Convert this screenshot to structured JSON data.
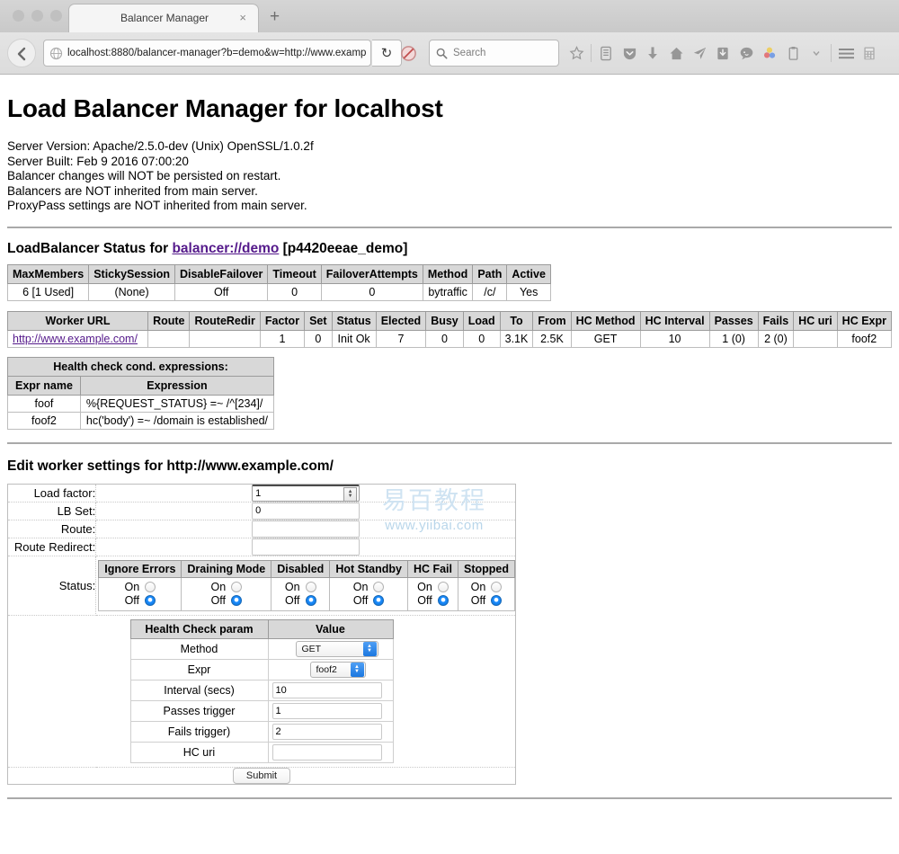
{
  "browser": {
    "tab_title": "Balancer Manager",
    "close_label": "×",
    "newtab_label": "+",
    "url": "localhost:8880/balancer-manager?b=demo&w=http://www.examp",
    "reload_label": "↻",
    "search_placeholder": "Search",
    "toolbar_icons": [
      "star-icon",
      "reader-list-icon",
      "pocket-icon",
      "download-icon",
      "home-icon",
      "send-icon",
      "save-page-icon",
      "chat-icon",
      "colorful-dots-icon",
      "clipboard-icon",
      "chevron-down-icon",
      "hamburger-menu-icon",
      "calculator-icon"
    ]
  },
  "page": {
    "title": "Load Balancer Manager for localhost",
    "server_info": [
      "Server Version: Apache/2.5.0-dev (Unix) OpenSSL/1.0.2f",
      "Server Built: Feb 9 2016 07:00:20",
      "Balancer changes will NOT be persisted on restart.",
      "Balancers are NOT inherited from main server.",
      "ProxyPass settings are NOT inherited from main server."
    ],
    "status_heading_prefix": "LoadBalancer Status for ",
    "status_heading_link": "balancer://demo",
    "status_heading_suffix": " [p4420eeae_demo]",
    "balancer_table": {
      "headers": [
        "MaxMembers",
        "StickySession",
        "DisableFailover",
        "Timeout",
        "FailoverAttempts",
        "Method",
        "Path",
        "Active"
      ],
      "row": [
        "6 [1 Used]",
        "(None)",
        "Off",
        "0",
        "0",
        "bytraffic",
        "/c/",
        "Yes"
      ]
    },
    "worker_table": {
      "headers": [
        "Worker URL",
        "Route",
        "RouteRedir",
        "Factor",
        "Set",
        "Status",
        "Elected",
        "Busy",
        "Load",
        "To",
        "From",
        "HC Method",
        "HC Interval",
        "Passes",
        "Fails",
        "HC uri",
        "HC Expr"
      ],
      "row": {
        "worker_url": "http://www.example.com/",
        "route": "",
        "route_redir": "",
        "factor": "1",
        "set": "0",
        "status": "Init Ok",
        "elected": "7",
        "busy": "0",
        "load": "0",
        "to": "3.1K",
        "from": "2.5K",
        "hc_method": "GET",
        "hc_interval": "10",
        "passes": "1 (0)",
        "fails": "2 (0)",
        "hc_uri": "",
        "hc_expr": "foof2"
      }
    },
    "hc_expr_table": {
      "caption": "Health check cond. expressions:",
      "headers": [
        "Expr name",
        "Expression"
      ],
      "rows": [
        {
          "name": "foof",
          "expr": "%{REQUEST_STATUS} =~ /^[234]/"
        },
        {
          "name": "foof2",
          "expr": "hc('body') =~ /domain is established/"
        }
      ]
    },
    "edit_heading": "Edit worker settings for http://www.example.com/",
    "form": {
      "load_factor_label": "Load factor:",
      "load_factor_value": "1",
      "lb_set_label": "LB Set:",
      "lb_set_value": "0",
      "route_label": "Route:",
      "route_value": "",
      "route_redirect_label": "Route Redirect:",
      "route_redirect_value": "",
      "status_label": "Status:",
      "status_headers": [
        "Ignore Errors",
        "Draining Mode",
        "Disabled",
        "Hot Standby",
        "HC Fail",
        "Stopped"
      ],
      "on_label": "On",
      "off_label": "Off",
      "status_values": [
        "Off",
        "Off",
        "Off",
        "Off",
        "Off",
        "Off"
      ],
      "hc_headers": [
        "Health Check param",
        "Value"
      ],
      "hc_rows": [
        {
          "param": "Method",
          "value": "GET",
          "kind": "select"
        },
        {
          "param": "Expr",
          "value": "foof2",
          "kind": "select"
        },
        {
          "param": "Interval (secs)",
          "value": "10",
          "kind": "text"
        },
        {
          "param": "Passes trigger",
          "value": "1",
          "kind": "text"
        },
        {
          "param": "Fails trigger)",
          "value": "2",
          "kind": "text"
        },
        {
          "param": "HC uri",
          "value": "",
          "kind": "text"
        }
      ],
      "submit_label": "Submit"
    },
    "watermark_cn": "易百教程",
    "watermark_en": "www.yiibai.com"
  },
  "colors": {
    "link": "#551a8b",
    "header_bg": "#d8d8d8",
    "radio_on": "#1b77e0",
    "watermark": "#cfe3f2"
  }
}
